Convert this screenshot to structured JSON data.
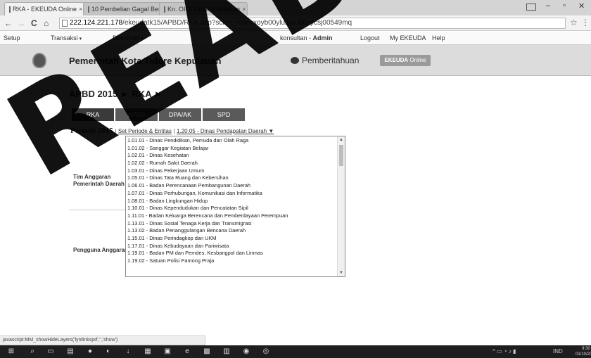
{
  "browser": {
    "tabs": [
      {
        "label": "RKA - EKEUDA Online",
        "active": true
      },
      {
        "label": "10 Pembelian Gagal Bersi",
        "active": false
      },
      {
        "label": "Kn. OIOI Gidak Kebijakan",
        "active": false
      }
    ],
    "url_host": "222.124.221.178",
    "url_path": "/ekeudatk15/APBD/RKA.asp?scid=_mqrwxoyb00ylulljylul00qfcsj00549mq"
  },
  "menubar": {
    "setup": "Setup",
    "transaksi": "Transaksi",
    "dokumen": "Dokumen",
    "user_prefix": "konsultan - ",
    "user_name": "Admin",
    "logout": "Logout",
    "my_ekeuda": "My EKEUDA",
    "help": "Help"
  },
  "header": {
    "title": "Pemerintah Kota Tidore Kepulauan",
    "notification": "Pemberitahuan",
    "ekeuda_brand": "EKEUDA",
    "ekeuda_suffix": " Online"
  },
  "main": {
    "breadcrumb": "APBD 2015 ► RKA ►",
    "tabs": [
      "RKA",
      "APBD",
      "DPA/AK",
      "SPD"
    ],
    "periode_label": "Periode 2015",
    "set_periode": "Set Periode & Entitas",
    "unit_link": "1.20.05 - Dinas Pendapatan Daerah ▼",
    "label_tim": "Tim Anggaran Pemerintah Daerah",
    "label_pengguna": "Pengguna Anggaran"
  },
  "dropdown": {
    "options": [
      "1.01.01 - Dinas Pendidikan, Pemuda dan Olah Raga",
      "1.01.02 - Sanggar Kegiatan Belajar",
      "1.02.01 - Dinas Kesehatan",
      "1.02.02 - Rumah Sakit Daerah",
      "1.03.01 - Dinas Pekerjaan Umum",
      "1.05.01 - Dinas Tata Ruang dan Kebersihan",
      "1.06.01 - Badan Perencanaan Pembangunan Daerah",
      "1.07.01 - Dinas Perhubungan, Komunikasi dan Informatika",
      "1.08.01 - Badan Lingkungan Hidup",
      "1.10.01 - Dinas Kependudukan dan Pencatatan Sipil",
      "1.11.01 - Badan Keluarga Berencana dan Pemberdayaan Perempuan",
      "1.13.01 - Dinas Sosial Tenaga Kerja dan Transmigrasi",
      "1.13.02 - Badan Penanggulangan Bencana Daerah",
      "1.15.01 - Dinas Perindagkop dan UKM",
      "1.17.01 - Dinas Kebudayaan dan Pariwisata",
      "1.19.01 - Badan PM dan Pemdes, Kesbangpol dan Linmas",
      "1.19.02 - Satuan Polisi Pamong Praja"
    ]
  },
  "statusbar": {
    "text": "javascript:MM_showHideLayers('lyrdinkspd','','show')"
  },
  "taskbar": {
    "tray_lang": "IND",
    "clock_time": "9:30",
    "clock_date": "01/10/2015"
  },
  "watermark": "READ"
}
